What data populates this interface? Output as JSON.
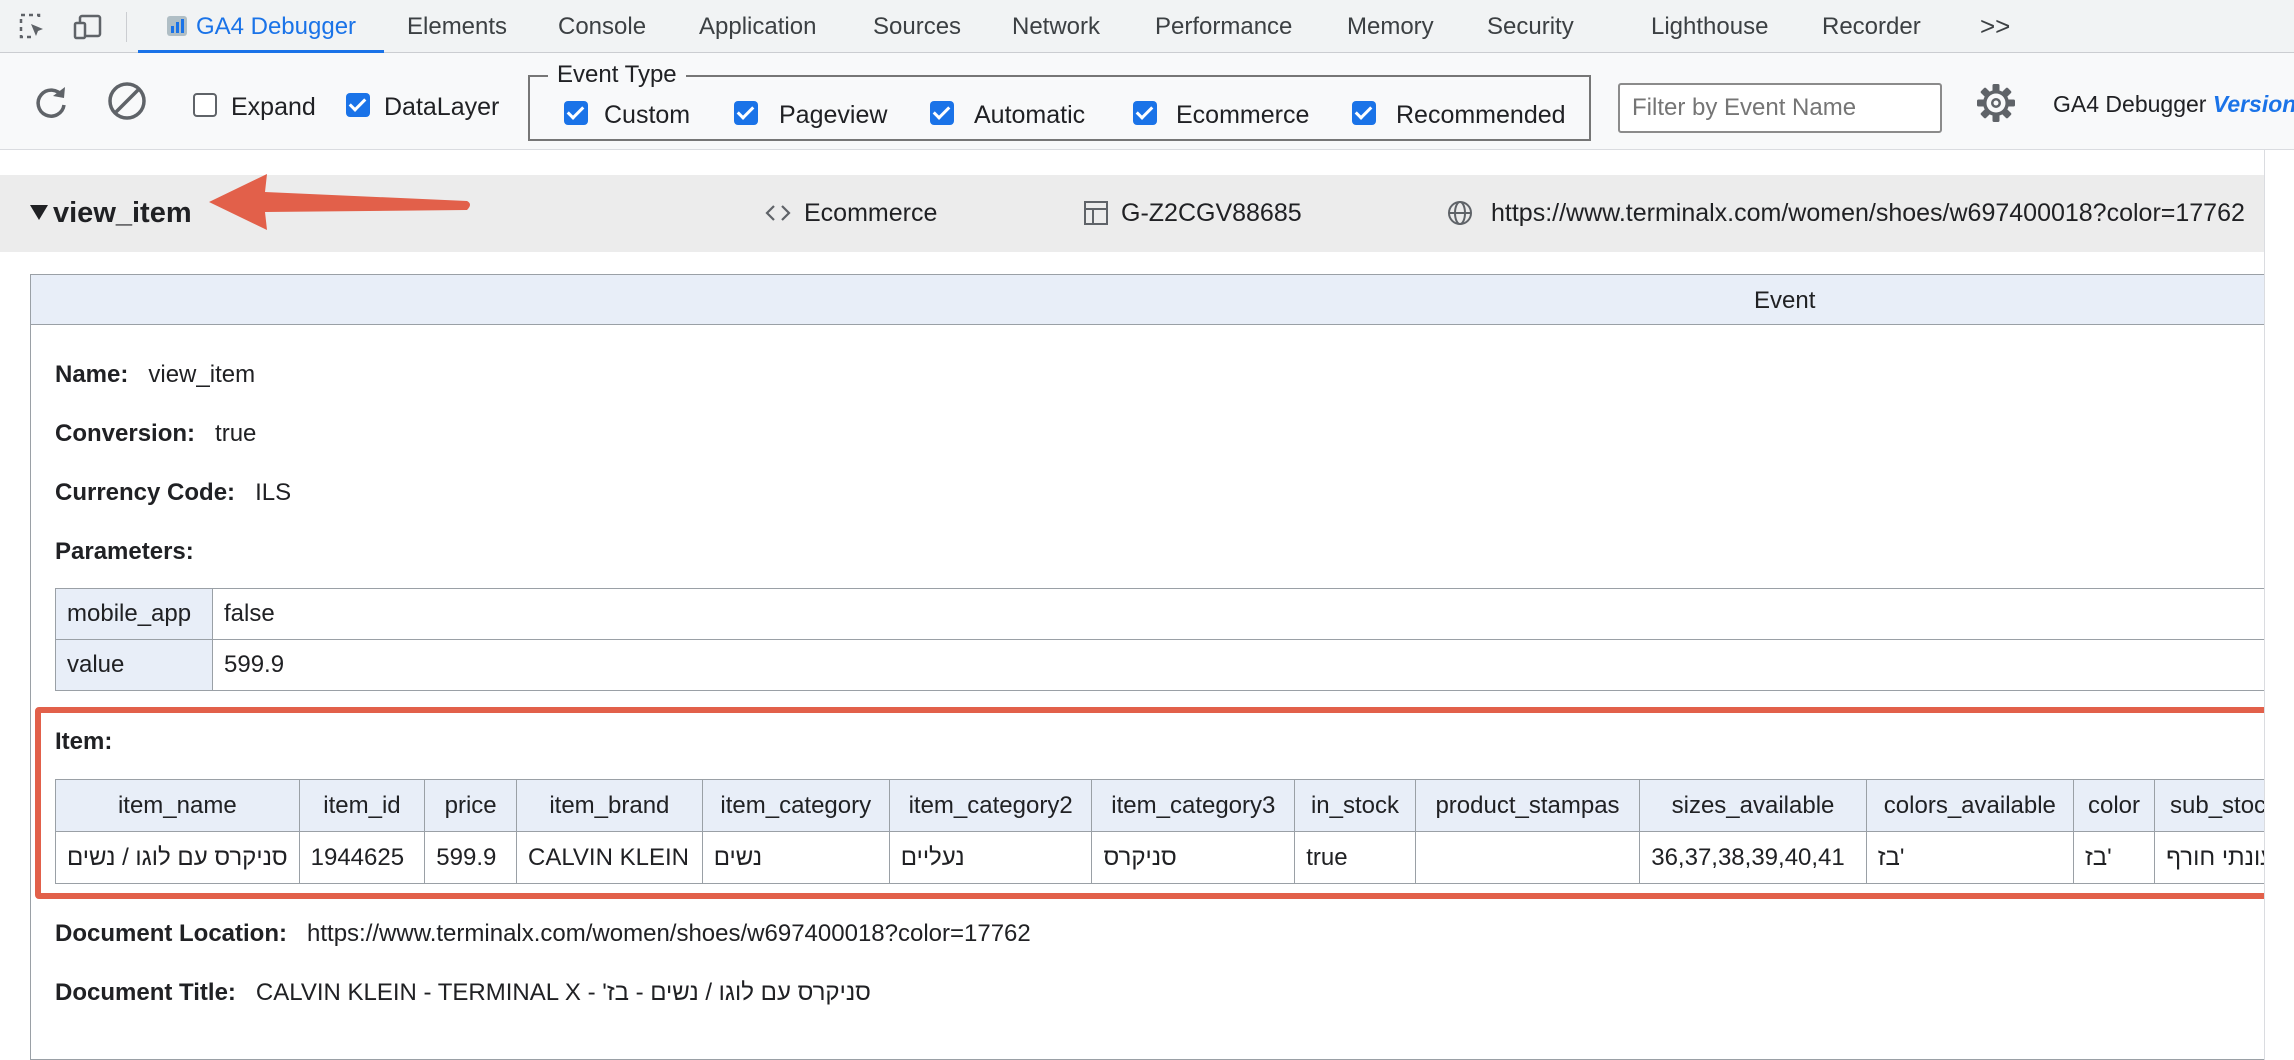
{
  "tabs": [
    {
      "label": "GA4 Debugger",
      "active": true
    },
    {
      "label": "Elements"
    },
    {
      "label": "Console"
    },
    {
      "label": "Application"
    },
    {
      "label": "Sources"
    },
    {
      "label": "Network"
    },
    {
      "label": "Performance"
    },
    {
      "label": "Memory"
    },
    {
      "label": "Security"
    },
    {
      "label": "Lighthouse"
    },
    {
      "label": "Recorder"
    }
  ],
  "tabs_overflow": ">>",
  "toolbar": {
    "expand_label": "Expand",
    "expand_checked": false,
    "datalayer_label": "DataLayer",
    "datalayer_checked": true,
    "event_type_legend": "Event Type",
    "event_types": [
      {
        "label": "Custom",
        "checked": true
      },
      {
        "label": "Pageview",
        "checked": true
      },
      {
        "label": "Automatic",
        "checked": true
      },
      {
        "label": "Ecommerce",
        "checked": true
      },
      {
        "label": "Recommended",
        "checked": true
      }
    ],
    "filter_placeholder": "Filter by Event Name",
    "app_name": "GA4 Debugger",
    "version_label": "Version"
  },
  "event_header": {
    "name": "view_item",
    "type": "Ecommerce",
    "measurement_id": "G-Z2CGV88685",
    "url": "https://www.terminalx.com/women/shoes/w697400018?color=17762"
  },
  "event": {
    "section_title": "Event",
    "name_label": "Name:",
    "name": "view_item",
    "conversion_label": "Conversion:",
    "conversion": "true",
    "currency_label": "Currency Code:",
    "currency": "ILS",
    "parameters_label": "Parameters:",
    "parameters": [
      {
        "key": "mobile_app",
        "value": "false"
      },
      {
        "key": "value",
        "value": "599.9"
      }
    ],
    "item_label": "Item:",
    "item_columns": [
      "item_name",
      "item_id",
      "price",
      "item_brand",
      "item_category",
      "item_category2",
      "item_category3",
      "in_stock",
      "product_stampas",
      "sizes_available",
      "colors_available",
      "color",
      "sub_stock"
    ],
    "item_rows": [
      [
        "סניקרס עם לוגו / נשים",
        "1944625",
        "599.9",
        "CALVIN KLEIN",
        "נשים",
        "נעליים",
        "סניקרס",
        "true",
        "",
        "36,37,38,39,40,41",
        "בז'",
        "בז'",
        "עונתי חורף"
      ]
    ],
    "doc_location_label": "Document Location:",
    "doc_location": "https://www.terminalx.com/women/shoes/w697400018?color=17762",
    "doc_title_label": "Document Title:",
    "doc_title": "סניקרס עם לוגו / נשים - בז' - CALVIN KLEIN - TERMINAL X"
  },
  "colors": {
    "accent": "#1a73e8",
    "highlight": "#e2604a",
    "header_bg": "#e8eef8"
  }
}
